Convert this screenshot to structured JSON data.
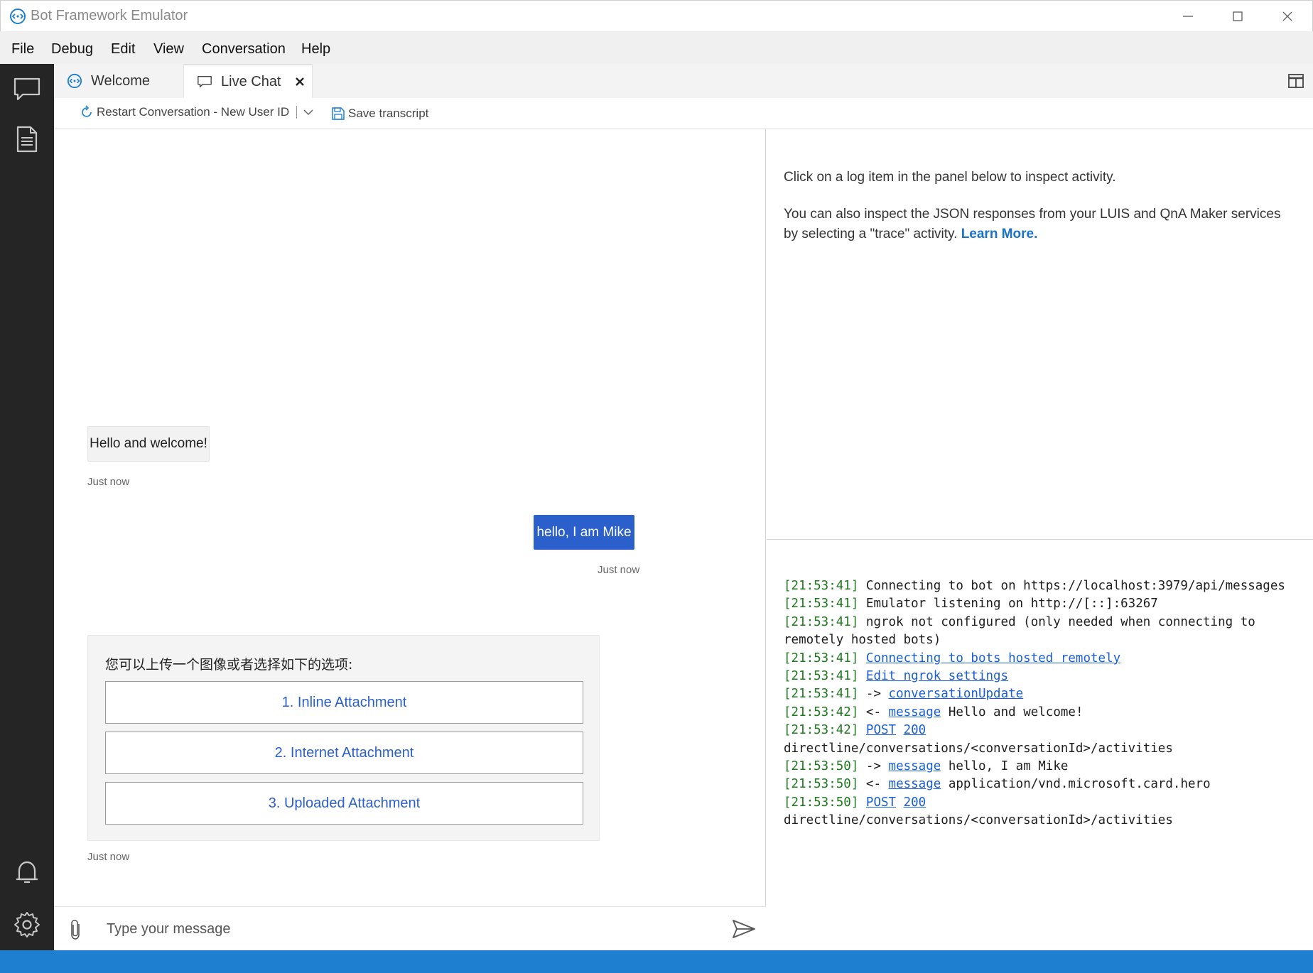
{
  "window": {
    "title": "Bot Framework Emulator"
  },
  "menu": [
    "File",
    "Debug",
    "Edit",
    "View",
    "Conversation",
    "Help"
  ],
  "sidebar": {
    "top_icons": [
      "chat-icon",
      "document-icon"
    ],
    "bottom_icons": [
      "bell-icon",
      "gear-icon"
    ]
  },
  "tabs": [
    {
      "label": "Welcome",
      "icon": "bot-icon",
      "active": false
    },
    {
      "label": "Live Chat",
      "icon": "chat-icon",
      "active": true
    }
  ],
  "toolbar": {
    "restart_label": "Restart Conversation - New User ID",
    "save_label": "Save transcript"
  },
  "chat": {
    "messages": [
      {
        "from": "bot",
        "text": "Hello and welcome!",
        "time": "Just now"
      },
      {
        "from": "user",
        "text": "hello, I am Mike",
        "time": "Just now"
      }
    ],
    "card": {
      "text": "您可以上传一个图像或者选择如下的选项:",
      "buttons": [
        "1. Inline Attachment",
        "2. Internet Attachment",
        "3. Uploaded Attachment"
      ],
      "time": "Just now"
    },
    "input_placeholder": "Type your message"
  },
  "inspector": {
    "line1": "Click on a log item in the panel below to inspect activity.",
    "line2": "You can also inspect the JSON responses from your LUIS and QnA Maker services by selecting a \"trace\" activity.",
    "learn_more": "Learn More."
  },
  "log": [
    {
      "time": "[21:53:41]",
      "prefix": "",
      "link": "",
      "link2": "",
      "text": "Connecting to bot on https://localhost:3979/api/messages"
    },
    {
      "time": "[21:53:41]",
      "prefix": "",
      "link": "",
      "link2": "",
      "text": "Emulator listening on http://[::]:63267"
    },
    {
      "time": "[21:53:41]",
      "prefix": "",
      "link": "",
      "link2": "",
      "text": "ngrok not configured (only needed when connecting to remotely hosted bots)"
    },
    {
      "time": "[21:53:41]",
      "prefix": "",
      "link": "Connecting to bots hosted remotely",
      "link2": "",
      "text": ""
    },
    {
      "time": "[21:53:41]",
      "prefix": "",
      "link": "Edit ngrok settings",
      "link2": "",
      "text": ""
    },
    {
      "time": "[21:53:41]",
      "prefix": "->",
      "link": "conversationUpdate",
      "link2": "",
      "text": ""
    },
    {
      "time": "[21:53:42]",
      "prefix": "<-",
      "link": "message",
      "link2": "",
      "text": "Hello and welcome!"
    },
    {
      "time": "[21:53:42]",
      "prefix": "",
      "link": "POST",
      "link2": "200",
      "text": "directline/conversations/<conversationId>/activities"
    },
    {
      "time": "[21:53:50]",
      "prefix": "->",
      "link": "message",
      "link2": "",
      "text": "hello, I am Mike"
    },
    {
      "time": "[21:53:50]",
      "prefix": "<-",
      "link": "message",
      "link2": "",
      "text": "application/vnd.microsoft.card.hero"
    },
    {
      "time": "[21:53:50]",
      "prefix": "",
      "link": "POST",
      "link2": "200",
      "text": "directline/conversations/<conversationId>/activities"
    }
  ],
  "colors": {
    "accent": "#2b5fcc",
    "sidebar": "#252526",
    "statusbar": "#1e7fd1",
    "log_time": "#1d7a1d"
  }
}
